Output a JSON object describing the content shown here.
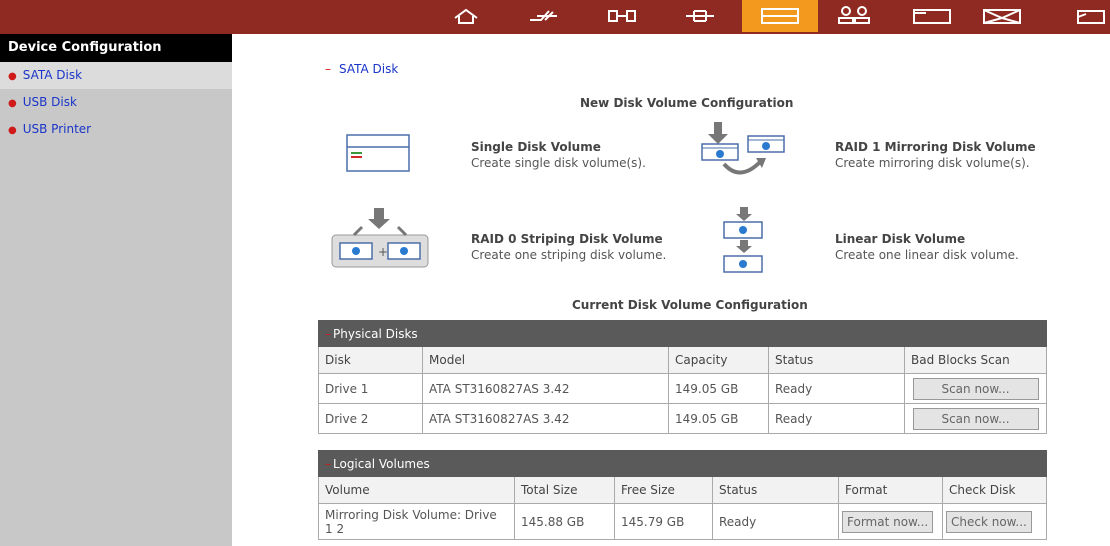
{
  "topbar": {
    "icons": [
      "home-icon",
      "tools-icon",
      "network-icon",
      "service-icon",
      "disk-icon",
      "users-icon",
      "folder-icon",
      "mail-icon",
      "more-icon"
    ],
    "active_color": "#f39a1e",
    "bar_color": "#8e2a22"
  },
  "sidebar": {
    "header": "Device Configuration",
    "items": [
      {
        "label": "SATA Disk"
      },
      {
        "label": "USB Disk"
      },
      {
        "label": "USB Printer"
      }
    ]
  },
  "main": {
    "section_title": "SATA Disk",
    "new_config_heading": "New Disk Volume Configuration",
    "options": [
      {
        "title": "Single Disk Volume",
        "desc": "Create single disk volume(s)."
      },
      {
        "title": "RAID 1 Mirroring Disk Volume",
        "desc": "Create mirroring disk volume(s)."
      },
      {
        "title": "RAID 0 Striping Disk Volume",
        "desc": "Create one striping disk volume."
      },
      {
        "title": "Linear Disk Volume",
        "desc": "Create one linear disk volume."
      }
    ],
    "current_config_heading": "Current Disk Volume Configuration"
  },
  "physical": {
    "title": "Physical Disks",
    "columns": [
      "Disk",
      "Model",
      "Capacity",
      "Status",
      "Bad Blocks Scan"
    ],
    "rows": [
      {
        "disk": "Drive 1",
        "model": "ATA ST3160827AS 3.42",
        "capacity": "149.05 GB",
        "status": "Ready",
        "action": "Scan now..."
      },
      {
        "disk": "Drive 2",
        "model": "ATA ST3160827AS 3.42",
        "capacity": "149.05 GB",
        "status": "Ready",
        "action": "Scan now..."
      }
    ]
  },
  "logical": {
    "title": "Logical Volumes",
    "columns": [
      "Volume",
      "Total Size",
      "Free Size",
      "Status",
      "Format",
      "Check Disk"
    ],
    "rows": [
      {
        "volume": "Mirroring Disk Volume: Drive 1 2",
        "total": "145.88 GB",
        "free": "145.79 GB",
        "status": "Ready",
        "format": "Format now...",
        "check": "Check now..."
      }
    ]
  }
}
